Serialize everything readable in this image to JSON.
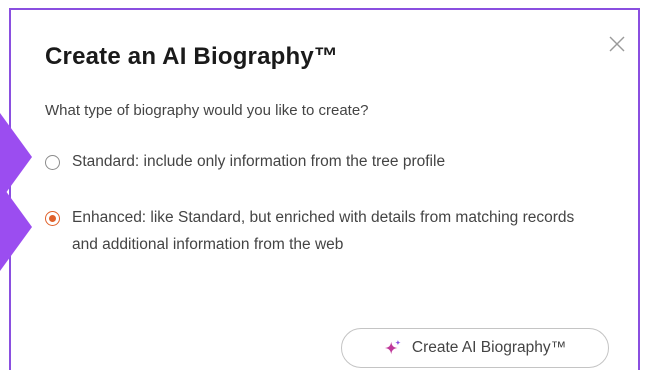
{
  "dialog": {
    "title": "Create an AI Biography™",
    "question": "What type of biography would you like to create?",
    "options": [
      {
        "label": "Standard: include only information from the tree profile",
        "selected": false
      },
      {
        "label": "Enhanced: like Standard, but enriched with details from matching records and additional information from the web",
        "selected": true
      }
    ],
    "create_button_label": "Create AI Biography™",
    "close_icon": "close-icon",
    "button_icon": "sparkle-icon"
  },
  "colors": {
    "frame": "#8a4fe0",
    "arrow": "#9b4df0",
    "radio_selected": "#e0612b",
    "sparkle_primary": "#c0399a",
    "sparkle_secondary": "#8a4fe0"
  }
}
